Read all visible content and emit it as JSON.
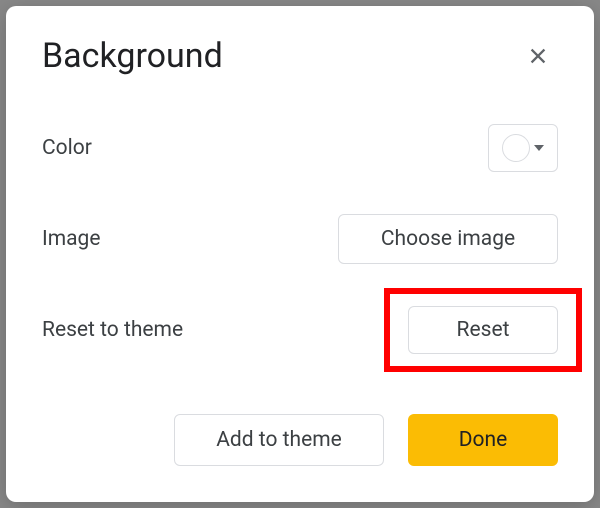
{
  "dialog": {
    "title": "Background",
    "rows": {
      "color_label": "Color",
      "image_label": "Image",
      "reset_label": "Reset to theme"
    },
    "buttons": {
      "choose_image": "Choose image",
      "reset": "Reset",
      "add_to_theme": "Add to theme",
      "done": "Done"
    },
    "colors": {
      "swatch": "#ffffff",
      "accent": "#fbbc04",
      "highlight": "#ff0000"
    }
  }
}
